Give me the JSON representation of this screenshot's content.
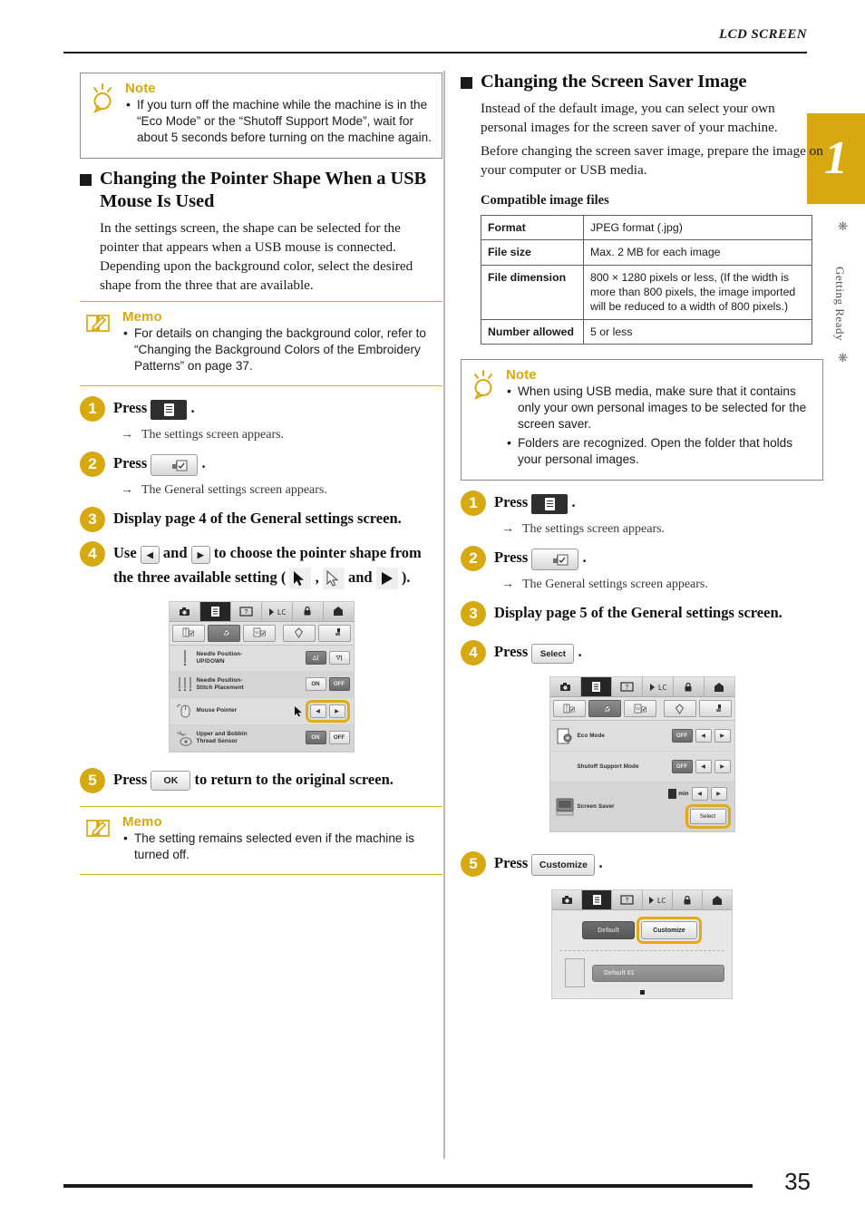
{
  "header": {
    "title": "LCD SCREEN"
  },
  "chapter": {
    "number": "1",
    "vertical_label": "Getting Ready"
  },
  "footer": {
    "page_number": "35"
  },
  "left": {
    "note": {
      "title": "Note",
      "items": [
        "If you turn off the machine while the machine is in the “Eco Mode” or the “Shutoff Support Mode”, wait for about 5 seconds before turning on the machine again."
      ]
    },
    "section": {
      "heading": "Changing the Pointer Shape When a USB Mouse Is Used",
      "paragraph": "In the settings screen, the shape can be selected for the pointer that appears when a USB mouse is connected. Depending upon the background color, select the desired shape from the three that are available."
    },
    "memo_top": {
      "title": "Memo",
      "items": [
        "For details on changing the background color, refer to “Changing the Background Colors of the Embroidery Patterns” on page 37."
      ]
    },
    "steps": [
      {
        "num": "1",
        "text_before": "Press",
        "text_after": ".",
        "result": "The settings screen appears."
      },
      {
        "num": "2",
        "text_before": "Press",
        "text_after": ".",
        "result": "The General settings screen appears."
      },
      {
        "num": "3",
        "text": "Display page 4 of the General settings screen."
      },
      {
        "num": "4",
        "t1": "Use",
        "t2": "and",
        "t3": "to choose the pointer shape from the three available setting (",
        "t4": ",",
        "t5": "and",
        "t6": ")."
      },
      {
        "num": "5",
        "text_before": "Press",
        "text_after": "to return to the original screen.",
        "key_label": "OK"
      }
    ],
    "memo_bottom": {
      "title": "Memo",
      "items": [
        "The setting remains selected even if the machine is turned off."
      ]
    },
    "lcd": {
      "rows": [
        {
          "label": "Needle Position-\nUP/DOWN",
          "icon": "needle-icon",
          "control": "segmented"
        },
        {
          "label": "Needle Position-\nStitch Placement",
          "icon": "needles-icon",
          "on": "ON",
          "off": "OFF",
          "selected": "OFF"
        },
        {
          "label": "Mouse Pointer",
          "icon": "mouse-icon",
          "control": "arrows",
          "highlighted": true
        },
        {
          "label": "Upper and Bobbin\nThread Sensor",
          "icon": "thread-sensor-icon",
          "on": "ON",
          "off": "OFF",
          "selected": "ON"
        }
      ]
    }
  },
  "right": {
    "section": {
      "heading": "Changing the Screen Saver Image",
      "paragraph1": "Instead of the default image, you can select your own personal images for the screen saver of your machine.",
      "paragraph2": "Before changing the screen saver image, prepare the image on your computer or USB media.",
      "table_title": "Compatible image files"
    },
    "table": {
      "rows": [
        {
          "key": "Format",
          "value": "JPEG format (.jpg)"
        },
        {
          "key": "File size",
          "value": "Max. 2 MB for each image"
        },
        {
          "key": "File dimension",
          "value": "800 × 1280 pixels or less, (If the width is more than 800 pixels, the image imported will be reduced to a width of 800 pixels.)"
        },
        {
          "key": "Number allowed",
          "value": "5 or less"
        }
      ]
    },
    "note": {
      "title": "Note",
      "items": [
        "When using USB media, make sure that it contains only your own personal images to be selected for the screen saver.",
        "Folders are recognized. Open the folder that holds your personal images."
      ]
    },
    "steps": [
      {
        "num": "1",
        "text_before": "Press",
        "text_after": ".",
        "result": "The settings screen appears."
      },
      {
        "num": "2",
        "text_before": "Press",
        "text_after": ".",
        "result": "The General settings screen appears."
      },
      {
        "num": "3",
        "text": "Display page 5 of the General settings screen."
      },
      {
        "num": "4",
        "text_before": "Press",
        "text_after": ".",
        "key_label": "Select"
      },
      {
        "num": "5",
        "text_before": "Press",
        "text_after": ".",
        "key_label": "Customize"
      }
    ],
    "lcd_page5": {
      "rows": [
        {
          "label": "Eco Mode",
          "value": "OFF"
        },
        {
          "label": "Shutoff Support Mode",
          "value": "OFF"
        }
      ],
      "screen_saver_label": "Screen Saver",
      "minutes_unit": "min",
      "select_label": "Select"
    },
    "lcd_customize": {
      "default_label": "Default",
      "customize_label": "Customize",
      "item_label": "Default 01"
    }
  }
}
